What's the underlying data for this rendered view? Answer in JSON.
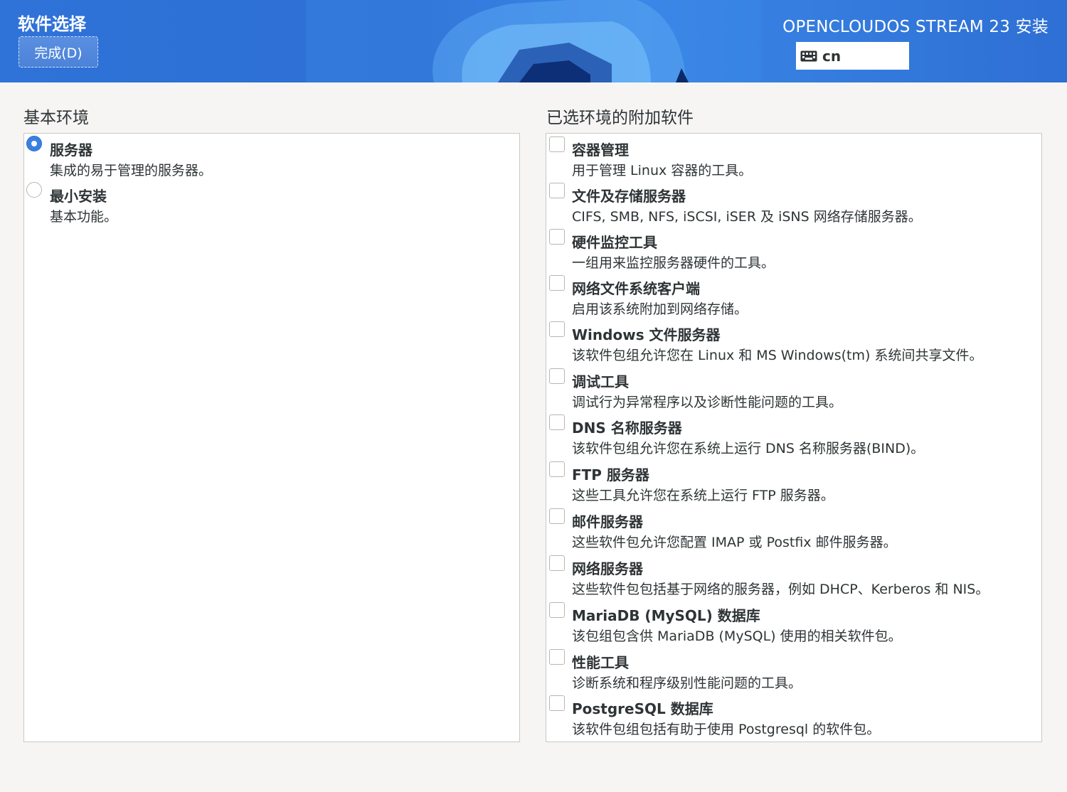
{
  "header": {
    "page_title": "软件选择",
    "done_label": "完成(D)",
    "product_title": "OPENCLOUDOS STREAM 23 安装",
    "keyboard_layout": "cn",
    "keyboard_icon": "keyboard-icon"
  },
  "base_environment": {
    "title": "基本环境",
    "items": [
      {
        "name": "服务器",
        "desc": "集成的易于管理的服务器。",
        "selected": true
      },
      {
        "name": "最小安装",
        "desc": "基本功能。",
        "selected": false
      }
    ]
  },
  "addons": {
    "title": "已选环境的附加软件",
    "items": [
      {
        "name": "容器管理",
        "desc": "用于管理 Linux 容器的工具。",
        "checked": false
      },
      {
        "name": "文件及存储服务器",
        "desc": "CIFS, SMB, NFS, iSCSI, iSER 及 iSNS 网络存储服务器。",
        "checked": false
      },
      {
        "name": "硬件监控工具",
        "desc": "一组用来监控服务器硬件的工具。",
        "checked": false
      },
      {
        "name": "网络文件系统客户端",
        "desc": "启用该系统附加到网络存储。",
        "checked": false
      },
      {
        "name": "Windows 文件服务器",
        "desc": "该软件包组允许您在 Linux 和 MS Windows(tm) 系统间共享文件。",
        "checked": false
      },
      {
        "name": "调试工具",
        "desc": "调试行为异常程序以及诊断性能问题的工具。",
        "checked": false
      },
      {
        "name": "DNS 名称服务器",
        "desc": "该软件包组允许您在系统上运行 DNS 名称服务器(BIND)。",
        "checked": false
      },
      {
        "name": "FTP 服务器",
        "desc": "这些工具允许您在系统上运行 FTP 服务器。",
        "checked": false
      },
      {
        "name": "邮件服务器",
        "desc": "这些软件包允许您配置 IMAP 或 Postfix 邮件服务器。",
        "checked": false
      },
      {
        "name": "网络服务器",
        "desc": "这些软件包包括基于网络的服务器，例如 DHCP、Kerberos 和 NIS。",
        "checked": false
      },
      {
        "name": "MariaDB (MySQL) 数据库",
        "desc": "该包组包含供 MariaDB (MySQL) 使用的相关软件包。",
        "checked": false
      },
      {
        "name": "性能工具",
        "desc": "诊断系统和程序级别性能问题的工具。",
        "checked": false
      },
      {
        "name": "PostgreSQL 数据库",
        "desc": "该软件包组包括有助于使用 Postgresql 的软件包。",
        "checked": false
      }
    ]
  }
}
